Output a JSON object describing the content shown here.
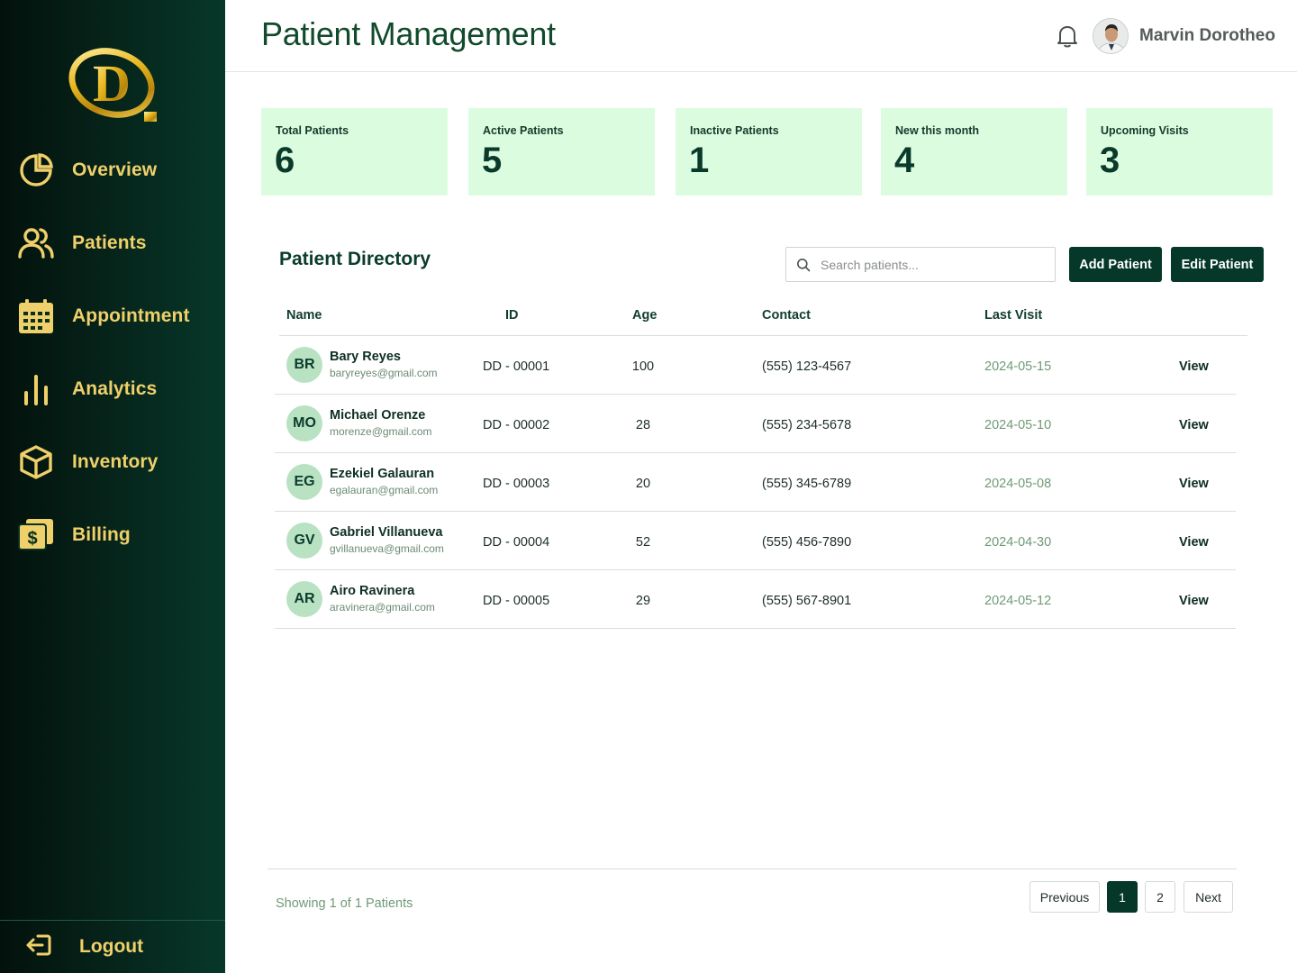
{
  "sidebar": {
    "brand_letter": "D",
    "items": [
      {
        "label": "Overview",
        "icon": "pie-chart-icon"
      },
      {
        "label": "Patients",
        "icon": "users-icon"
      },
      {
        "label": "Appointment",
        "icon": "calendar-icon"
      },
      {
        "label": "Analytics",
        "icon": "bar-chart-icon"
      },
      {
        "label": "Inventory",
        "icon": "box-icon"
      },
      {
        "label": "Billing",
        "icon": "dollar-bill-icon"
      }
    ],
    "logout_label": "Logout"
  },
  "header": {
    "title": "Patient Management",
    "user_name": "Marvin Dorotheo"
  },
  "stats": [
    {
      "label": "Total Patients",
      "value": "6"
    },
    {
      "label": "Active Patients",
      "value": "5"
    },
    {
      "label": "Inactive Patients",
      "value": "1"
    },
    {
      "label": "New this month",
      "value": "4"
    },
    {
      "label": "Upcoming Visits",
      "value": "3"
    }
  ],
  "directory": {
    "title": "Patient Directory",
    "search_placeholder": "Search patients...",
    "add_label": "Add Patient",
    "edit_label": "Edit Patient",
    "columns": [
      "Name",
      "ID",
      "Age",
      "Contact",
      "Last Visit"
    ],
    "rows": [
      {
        "initials": "BR",
        "name": "Bary Reyes",
        "email": "baryreyes@gmail.com",
        "id": "DD - 00001",
        "age": "100",
        "contact": "(555) 123-4567",
        "last_visit": "2024-05-15",
        "action": "View"
      },
      {
        "initials": "MO",
        "name": "Michael Orenze",
        "email": "morenze@gmail.com",
        "id": "DD - 00002",
        "age": "28",
        "contact": "(555) 234-5678",
        "last_visit": "2024-05-10",
        "action": "View"
      },
      {
        "initials": "EG",
        "name": "Ezekiel Galauran",
        "email": "egalauran@gmail.com",
        "id": "DD - 00003",
        "age": "20",
        "contact": "(555) 345-6789",
        "last_visit": "2024-05-08",
        "action": "View"
      },
      {
        "initials": "GV",
        "name": "Gabriel Villanueva",
        "email": "gvillanueva@gmail.com",
        "id": "DD - 00004",
        "age": "52",
        "contact": "(555) 456-7890",
        "last_visit": "2024-04-30",
        "action": "View"
      },
      {
        "initials": "AR",
        "name": "Airo Ravinera",
        "email": "aravinera@gmail.com",
        "id": "DD - 00005",
        "age": "29",
        "contact": "(555) 567-8901",
        "last_visit": "2024-05-12",
        "action": "View"
      }
    ]
  },
  "footer": {
    "showing_text": "Showing 1 of 1 Patients",
    "previous_label": "Previous",
    "pages": [
      "1",
      "2"
    ],
    "current_page": "1",
    "next_label": "Next"
  },
  "colors": {
    "sidebar_dark": "#03110c",
    "sidebar_green": "#07382a",
    "gold": "#efd06a",
    "card_bg": "#dcfce0",
    "primary_button": "#06382a",
    "visit_date": "#6f9a76"
  }
}
